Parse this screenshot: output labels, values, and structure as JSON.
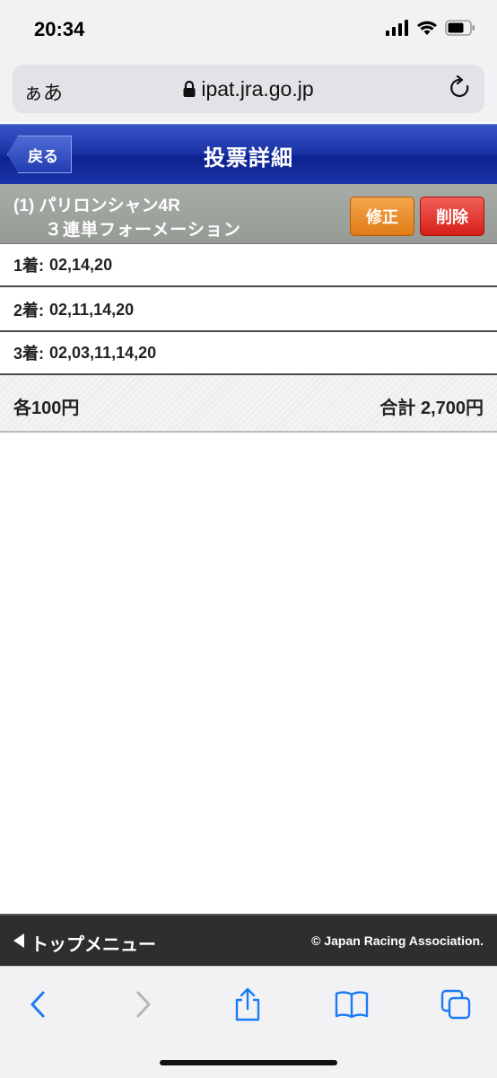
{
  "status_bar": {
    "time": "20:34"
  },
  "browser": {
    "aa_label": "ぁあ",
    "url": "ipat.jra.go.jp"
  },
  "header": {
    "back_label": "戻る",
    "title": "投票詳細"
  },
  "race": {
    "line1": "(1) パリロンシャン4R",
    "line2": "３連単フォーメーション",
    "modify_label": "修正",
    "delete_label": "削除"
  },
  "selections": [
    {
      "label": "1着:",
      "numbers": "02,14,20"
    },
    {
      "label": "2着:",
      "numbers": "02,11,14,20"
    },
    {
      "label": "3着:",
      "numbers": "02,03,11,14,20"
    }
  ],
  "amounts": {
    "each": "各100円",
    "total": "合計 2,700円"
  },
  "footer": {
    "top_menu_label": "トップメニュー",
    "copyright": "© Japan Racing Association."
  },
  "colors": {
    "header_blue": "#1c36a8",
    "modify_orange": "#e07c16",
    "delete_red": "#d61f18",
    "race_header_gray": "#9a9f9a",
    "footer_dark": "#2e2e2e",
    "ios_blue": "#1a7cf5"
  }
}
